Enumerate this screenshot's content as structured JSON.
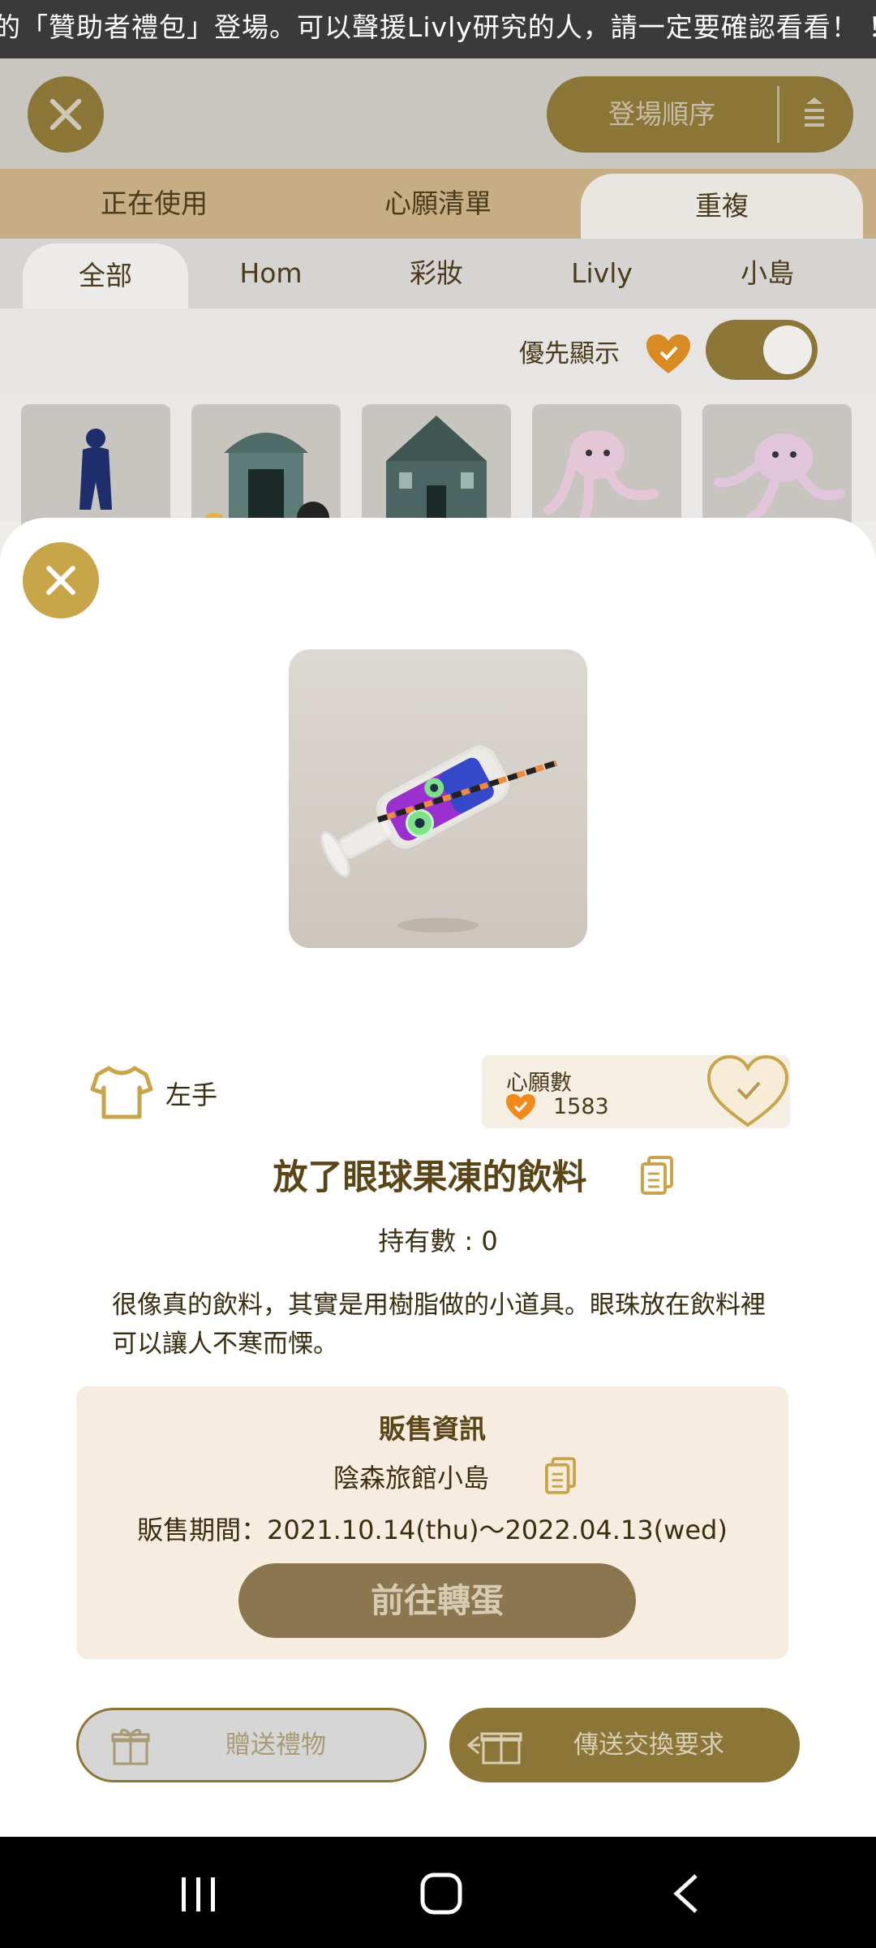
{
  "ticker": {
    "text": "的「贊助者禮包」登場。可以聲援Livly研究的人，請一定要確認看看！ ！"
  },
  "header": {
    "sort_label": "登場順序"
  },
  "tabs_primary": [
    "正在使用",
    "心願清單",
    "重複"
  ],
  "tabs_secondary": [
    "全部",
    "Hom",
    "彩妝",
    "Livly",
    "小島"
  ],
  "preference": {
    "label": "優先顯示"
  },
  "item": {
    "slot_label": "左手",
    "wish_title": "心願數",
    "wish_count": "1583",
    "name": "放了眼球果凍的飲料",
    "owned": "持有數 : 0",
    "description": "很像真的飲料，其實是用樹脂做的小道具。眼珠放在飲料裡可以讓人不寒而慄。"
  },
  "sale": {
    "title": "販售資訊",
    "place": "陰森旅館小島",
    "period": "販售期間：2021.10.14(thu)～2022.04.13(wed)",
    "gacha_button": "前往轉蛋"
  },
  "actions": {
    "gift_button": "贈送禮物",
    "trade_button": "傳送交換要求"
  },
  "colors": {
    "accent_gold": "#8c7637",
    "close_gold": "#c9a549",
    "heart_orange": "#f08a1c"
  }
}
